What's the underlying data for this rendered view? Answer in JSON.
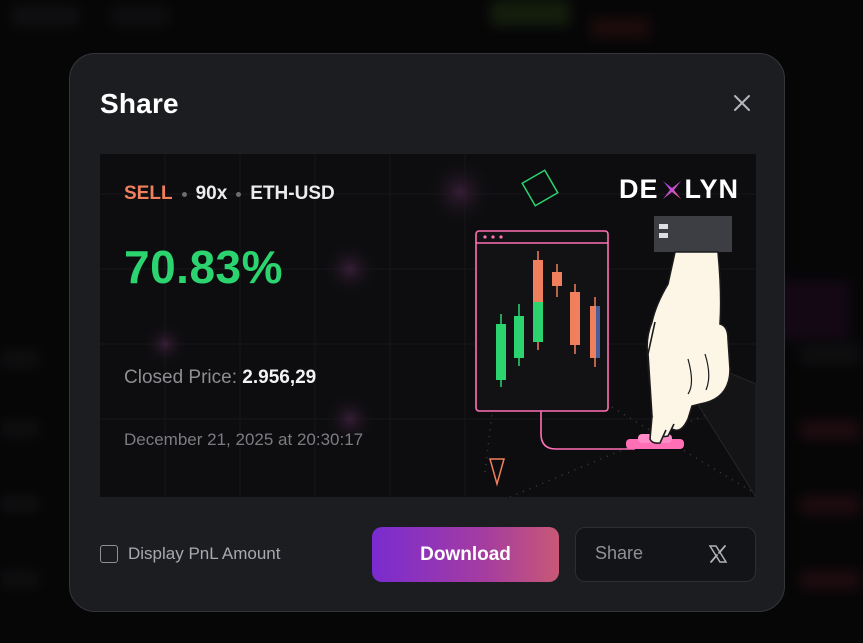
{
  "modal": {
    "title": "Share",
    "close_icon": "close-icon"
  },
  "card": {
    "side": "SELL",
    "leverage": "90x",
    "pair": "ETH-USD",
    "pnl_percent": "70.83%",
    "closed_price_label": "Closed Price:",
    "closed_price_value": "2.956,29",
    "date": "December 21, 2025 at 20:30:17",
    "brand_left": "DE",
    "brand_right": "LYN",
    "brand_mark_icon": "x-mark-icon"
  },
  "footer": {
    "checkbox_label": "Display PnL Amount",
    "checkbox_checked": false,
    "download_label": "Download",
    "share_label": "Share",
    "share_icon": "x-logo-icon"
  },
  "colors": {
    "sell": "#f0805d",
    "pnl_positive": "#2bd46f",
    "download_gradient_start": "#7a2bd0",
    "download_gradient_end": "#c85876",
    "modal_bg": "#1c1d21",
    "candle_up": "#2bd46f",
    "candle_down": "#f0805d",
    "accent_pink": "#ff6fb5"
  }
}
